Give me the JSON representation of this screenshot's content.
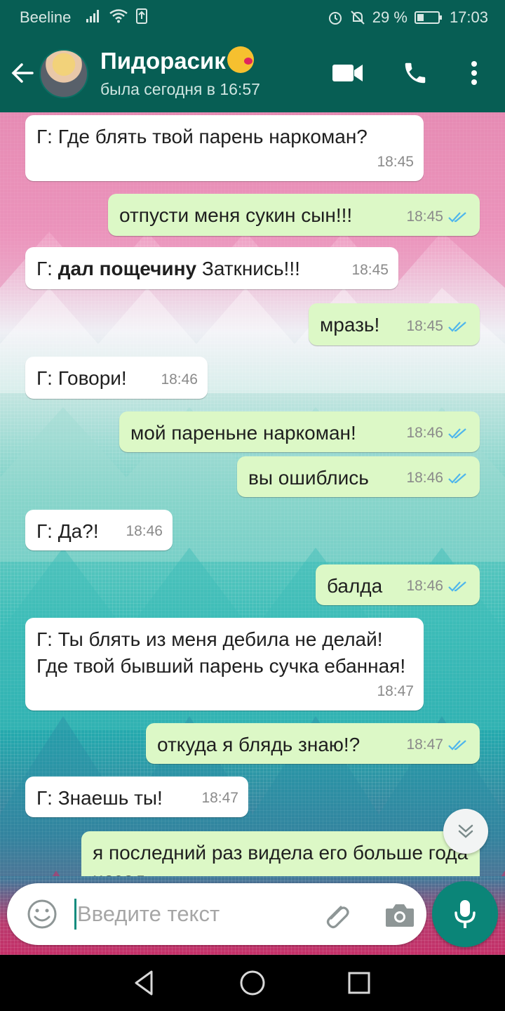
{
  "status_bar": {
    "carrier": "Beeline",
    "battery": "29 %",
    "time": "17:03"
  },
  "header": {
    "contact_name": "Пидорасик",
    "last_seen": "была сегодня в 16:57"
  },
  "messages": [
    {
      "dir": "in",
      "text": "Г: Где блять твой парень наркоман?",
      "time": "18:45"
    },
    {
      "dir": "out",
      "text": "отпусти меня сукин сын!!!",
      "time": "18:45"
    },
    {
      "dir": "in",
      "prefix": "Г: ",
      "bold": "дал пощечину",
      "rest": " Заткнись!!!",
      "time": "18:45"
    },
    {
      "dir": "out",
      "text": "мразь!",
      "time": "18:45"
    },
    {
      "dir": "in",
      "text": "Г: Говори!",
      "time": "18:46"
    },
    {
      "dir": "out",
      "text": "мой пареньне наркоман!",
      "time": "18:46"
    },
    {
      "dir": "out",
      "text": "вы ошиблись",
      "time": "18:46"
    },
    {
      "dir": "in",
      "text": "Г: Да?!",
      "time": "18:46"
    },
    {
      "dir": "out",
      "text": "балда",
      "time": "18:46"
    },
    {
      "dir": "in",
      "text": "Г: Ты блять из меня дебила не делай! Где твой бывший парень сучка ебанная!",
      "time": "18:47"
    },
    {
      "dir": "out",
      "text": "откуда я блядь знаю!?",
      "time": "18:47"
    },
    {
      "dir": "in",
      "text": "Г: Знаешь ты!",
      "time": "18:47"
    },
    {
      "dir": "out",
      "text": "я последний раз видела его больше года назад",
      "time": ""
    }
  ],
  "composer": {
    "placeholder": "Введите текст"
  },
  "colors": {
    "header": "#075e54",
    "outgoing_bubble": "#dcf8c6",
    "incoming_bubble": "#ffffff",
    "read_ticks": "#4fb6ec",
    "mic_button": "#0b8578"
  },
  "icons": [
    "back-arrow-icon",
    "video-call-icon",
    "phone-icon",
    "more-vert-icon",
    "emoji-icon",
    "attach-icon",
    "camera-icon",
    "mic-icon",
    "scroll-down-icon",
    "nav-back-icon",
    "nav-home-icon",
    "nav-recents-icon"
  ]
}
